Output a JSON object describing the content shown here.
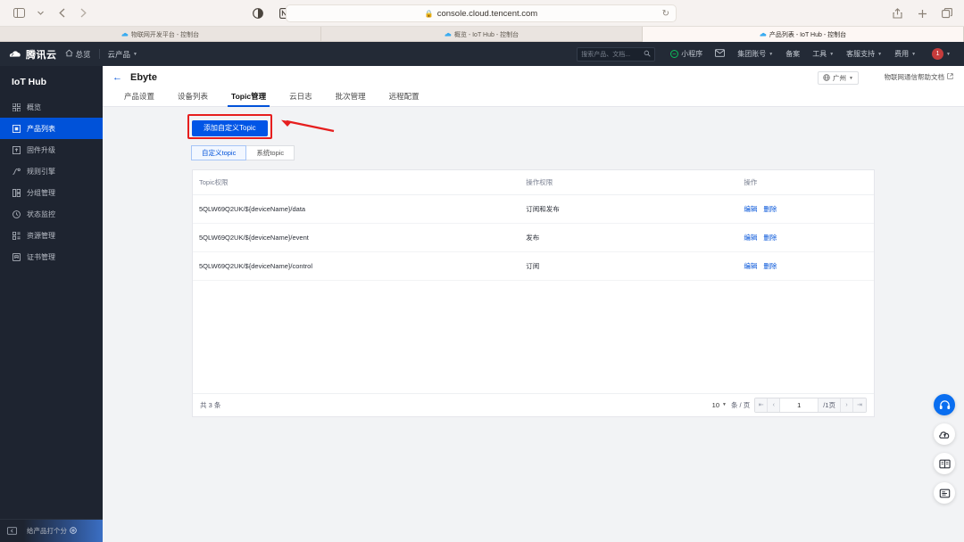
{
  "browser": {
    "url": "console.cloud.tencent.com",
    "lock_icon": "lock-icon",
    "reload_icon": "reload-icon",
    "back_icon": "back-arrow-icon",
    "forward_icon": "forward-arrow-icon",
    "sidebar_icon": "sidebar-toggle-icon",
    "reader_icon": "reader-mode-icon",
    "extension_icon": "notion-extension-icon",
    "share_icon": "share-icon",
    "newtab_icon": "new-tab-icon",
    "tabs_icon": "tab-overview-icon",
    "tabs": [
      {
        "title": "物联网开发平台 - 控制台",
        "active": false
      },
      {
        "title": "概览 - IoT Hub - 控制台",
        "active": false
      },
      {
        "title": "产品列表 - IoT Hub - 控制台",
        "active": true
      }
    ]
  },
  "topnav": {
    "brand": "腾讯云",
    "overview": "总览",
    "products": "云产品",
    "search_placeholder": "搜索产品、文档...",
    "items": [
      {
        "label": "小程序",
        "icon": "wechat-miniprogram-icon",
        "caret": false
      },
      {
        "label": "",
        "icon": "mail-icon",
        "caret": false
      },
      {
        "label": "集团账号",
        "icon": "",
        "caret": true
      },
      {
        "label": "备案",
        "icon": "",
        "caret": false
      },
      {
        "label": "工具",
        "icon": "",
        "caret": true
      },
      {
        "label": "客服支持",
        "icon": "",
        "caret": true
      },
      {
        "label": "费用",
        "icon": "",
        "caret": true
      }
    ],
    "avatar_text": "1"
  },
  "sidebar": {
    "title": "IoT Hub",
    "items": [
      {
        "label": "概览",
        "icon": "grid-icon",
        "active": false
      },
      {
        "label": "产品列表",
        "icon": "product-list-icon",
        "active": true
      },
      {
        "label": "固件升级",
        "icon": "firmware-upgrade-icon",
        "active": false
      },
      {
        "label": "规则引擎",
        "icon": "rule-engine-icon",
        "active": false
      },
      {
        "label": "分组管理",
        "icon": "group-manage-icon",
        "active": false
      },
      {
        "label": "状态监控",
        "icon": "status-monitor-icon",
        "active": false
      },
      {
        "label": "资源管理",
        "icon": "resource-manage-icon",
        "active": false
      },
      {
        "label": "证书管理",
        "icon": "certificate-icon",
        "active": false
      }
    ],
    "collapse_icon": "collapse-sidebar-icon",
    "rate_label": "给产品打个分",
    "rate_icon": "rate-gear-icon"
  },
  "page": {
    "back_icon": "back-arrow-icon",
    "title": "Ebyte",
    "region": "广州",
    "region_icon": "globe-icon",
    "help_link": "物联网通信帮助文档",
    "help_icon": "external-link-icon",
    "tabs": [
      {
        "label": "产品设置",
        "active": false
      },
      {
        "label": "设备列表",
        "active": false
      },
      {
        "label": "Topic管理",
        "active": true
      },
      {
        "label": "云日志",
        "active": false
      },
      {
        "label": "批次管理",
        "active": false
      },
      {
        "label": "远程配置",
        "active": false
      }
    ]
  },
  "toolbar": {
    "add_topic_label": "添加自定义Topic",
    "annotation": {
      "box_color": "#e61e1e",
      "arrow_color": "#e61e1e"
    }
  },
  "subtabs": [
    {
      "label": "自定义topic",
      "active": true
    },
    {
      "label": "系统topic",
      "active": false
    }
  ],
  "table": {
    "columns": [
      "Topic权限",
      "操作权限",
      "操作"
    ],
    "rows": [
      {
        "topic": "5QLW69Q2UK/${deviceName}/data",
        "permission": "订阅和发布",
        "edit": "编辑",
        "delete": "删除"
      },
      {
        "topic": "5QLW69Q2UK/${deviceName}/event",
        "permission": "发布",
        "edit": "编辑",
        "delete": "删除"
      },
      {
        "topic": "5QLW69Q2UK/${deviceName}/control",
        "permission": "订阅",
        "edit": "编辑",
        "delete": "删除"
      }
    ]
  },
  "pager": {
    "total_text": "共 3 条",
    "page_size": "10",
    "page_size_unit": "条 / 页",
    "current_page": "1",
    "total_pages": "/1页",
    "first_icon": "first-page-icon",
    "prev_icon": "prev-page-icon",
    "next_icon": "next-page-icon",
    "last_icon": "last-page-icon"
  },
  "rail": [
    {
      "icon": "headset-support-icon",
      "primary": true
    },
    {
      "icon": "cloud-upload-icon",
      "primary": false
    },
    {
      "icon": "book-docs-icon",
      "primary": false
    },
    {
      "icon": "list-menu-icon",
      "primary": false
    }
  ]
}
